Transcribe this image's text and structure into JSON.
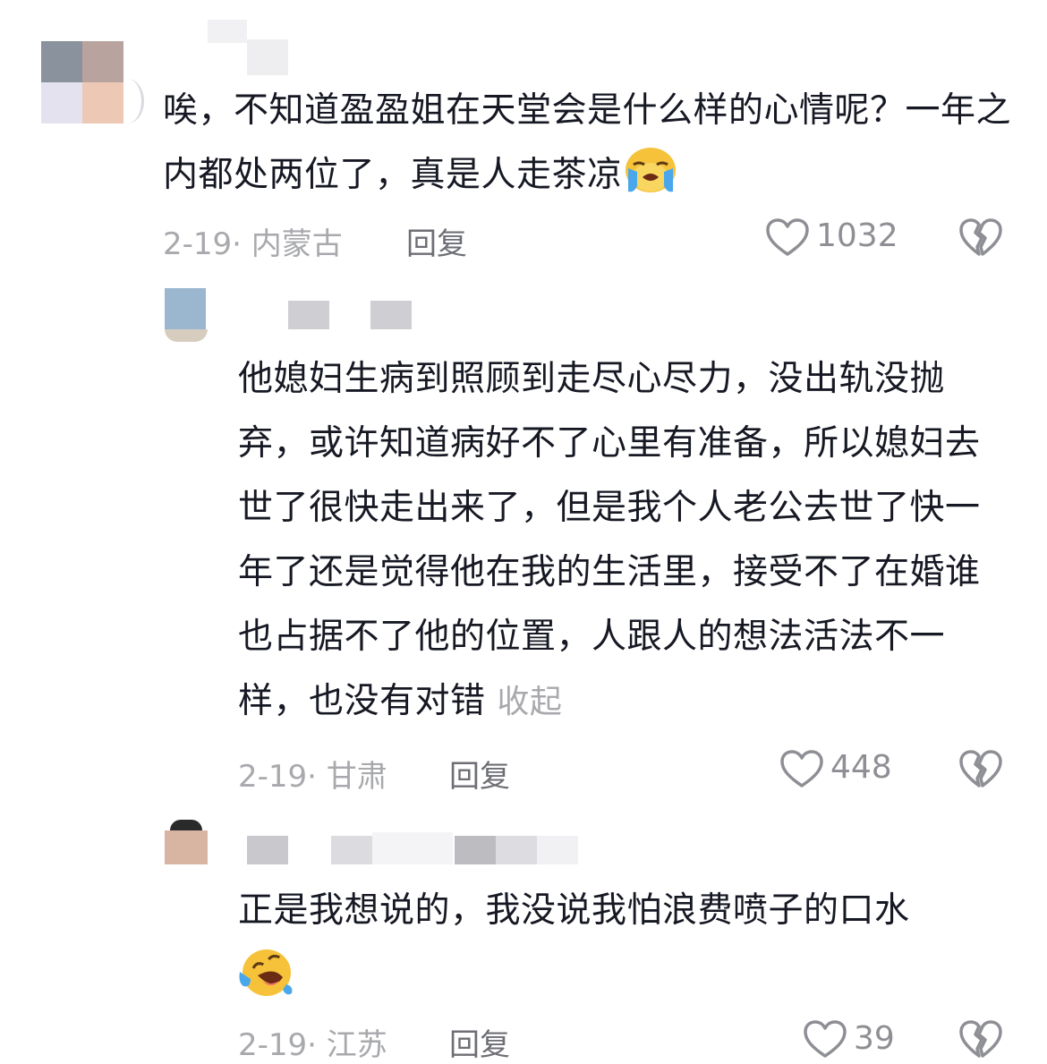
{
  "comments": [
    {
      "text": "唉，不知道盈盈姐在天堂会是什么样的心情呢？一年之内都处两位了，真是人走茶凉",
      "emoji": "loudly-crying-face",
      "date": "2-19·",
      "location": "内蒙古",
      "reply_label": "回复",
      "likes": "1032"
    },
    {
      "text": "他媳妇生病到照顾到走尽心尽力，没出轨没抛弃，或许知道病好不了心里有准备，所以媳妇去世了很快走出来了，但是我个人老公去世了快一年了还是觉得他在我的生活里，接受不了在婚谁也占据不了他的位置，人跟人的想法活法不一样，也没有对错",
      "collapse_label": "收起",
      "date": "2-19·",
      "location": "甘肃",
      "reply_label": "回复",
      "likes": "448"
    },
    {
      "text": "正是我想说的，我没说我怕浪费喷子的口水",
      "emoji": "rolling-on-the-floor-laughing",
      "date": "2-19·",
      "location": "江苏",
      "reply_label": "回复",
      "likes": "39"
    }
  ],
  "colors": {
    "text": "#161823",
    "meta": "#a8a9ad",
    "reply": "#6e6f75",
    "icon": "#8e8f94"
  }
}
